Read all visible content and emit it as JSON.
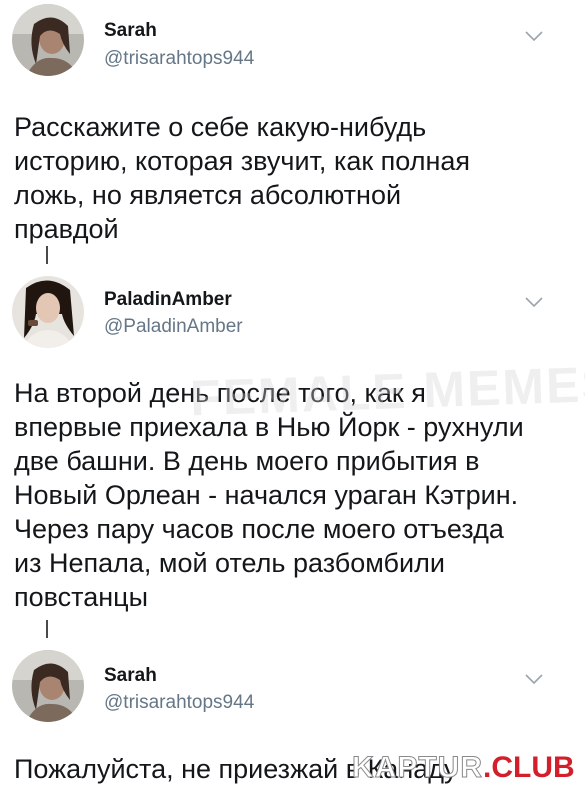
{
  "tweets": [
    {
      "name": "Sarah",
      "handle": "@trisarahtops944",
      "text": "Расскажите о себе какую-нибудь\nисторию, которая звучит, как полная\nложь, но является абсолютной\nправдой"
    },
    {
      "name": "PaladinAmber",
      "handle": "@PaladinAmber",
      "text": "На второй день после того, как я\nвпервые приехала в Нью Йорк - рухнули\nдве башни. В день моего прибытия в\nНовый Орлеан - начался ураган Кэтрин.\nЧерез пару часов после моего отъезда\nиз Непала,  мой отель разбомбили\nповстанцы"
    },
    {
      "name": "Sarah",
      "handle": "@trisarahtops944",
      "text": "Пожалуйста, не приезжай в Канаду"
    }
  ],
  "watermarks": {
    "faint": "FEMALE MEMES",
    "brand_part1": "KAPTUR",
    "brand_part2": ".CLUB",
    "brand_color": "#d21f2b"
  },
  "colors": {
    "handle": "#657786",
    "text": "#14171a"
  },
  "icons": [
    "avatar",
    "chevron-down-icon"
  ]
}
